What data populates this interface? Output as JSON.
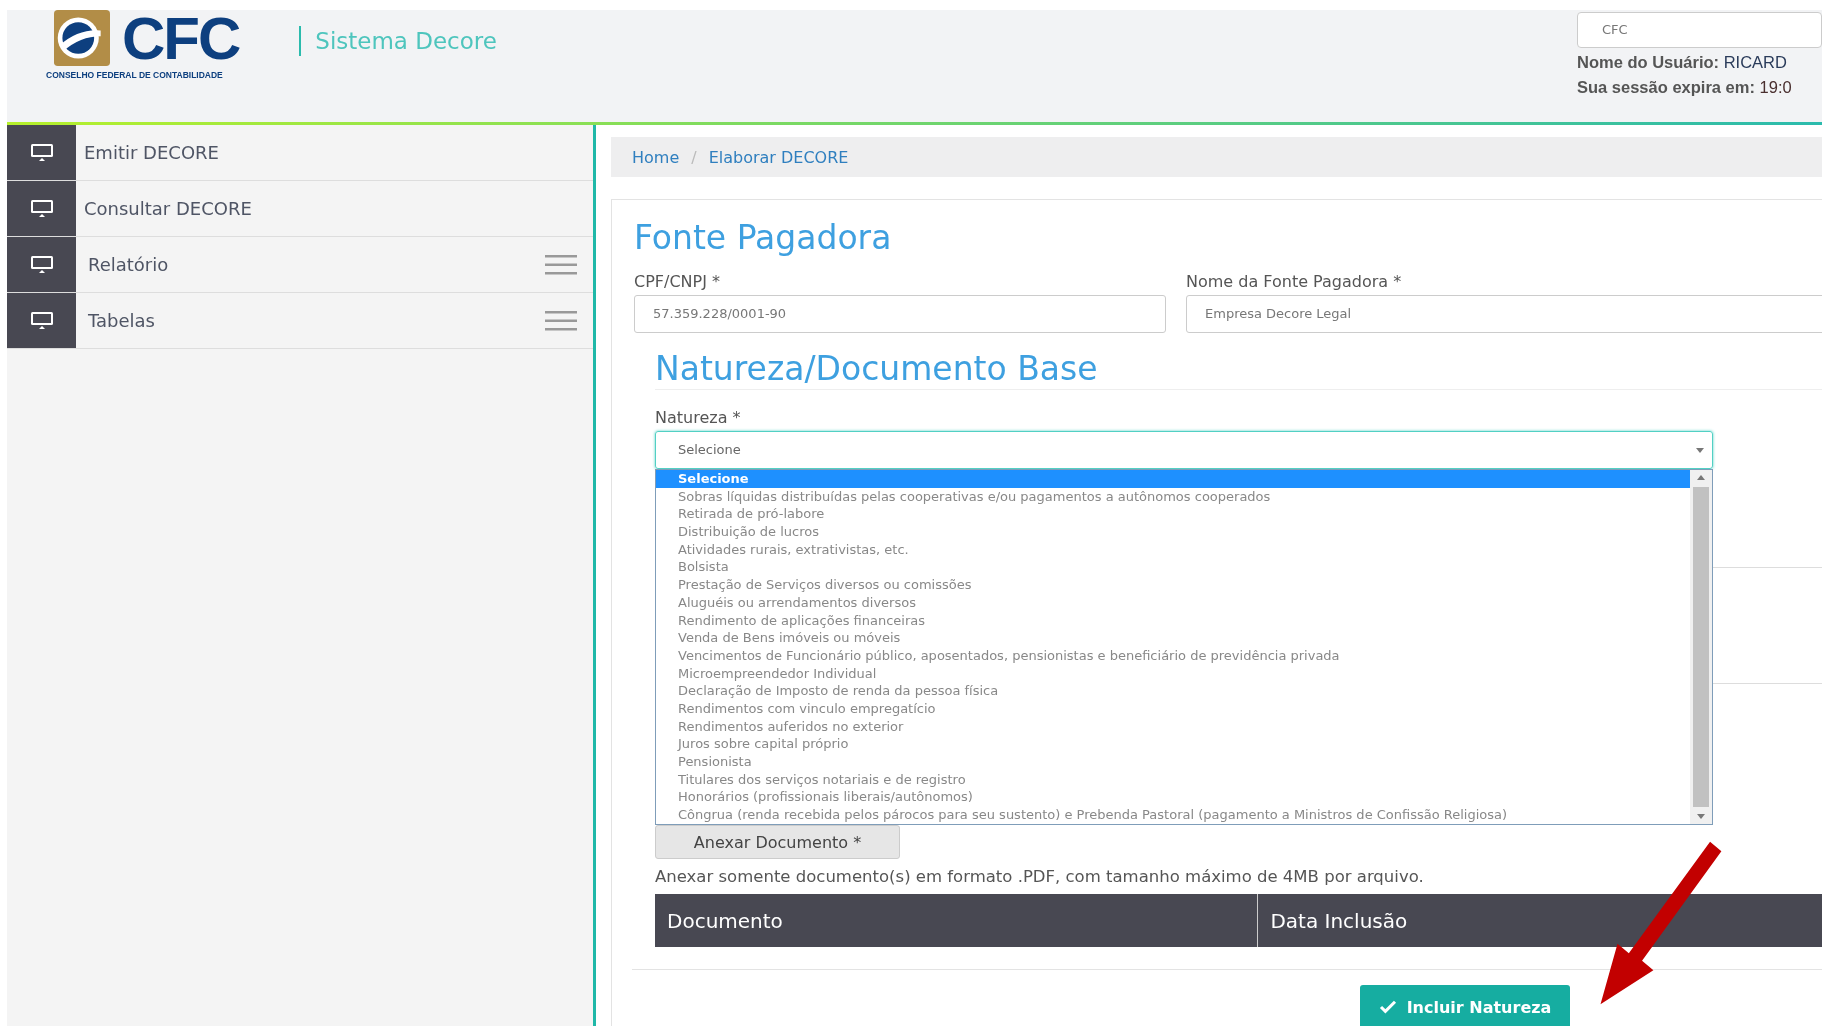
{
  "header": {
    "logo_mark": "CFC",
    "logo_caption": "CONSELHO FEDERAL DE CONTABILIDADE",
    "system_name": "Sistema Decore",
    "org_select": {
      "value": "CFC"
    },
    "user_label": "Nome do Usuário:",
    "user_value": "RICARD",
    "session_label": "Sua sessão expira em:",
    "session_value": "19:0"
  },
  "sidebar": {
    "items": [
      {
        "label": "Emitir DECORE",
        "kind": "link"
      },
      {
        "label": "Consultar DECORE",
        "kind": "link"
      },
      {
        "label": "Relatório",
        "kind": "menu"
      },
      {
        "label": "Tabelas",
        "kind": "menu"
      }
    ]
  },
  "breadcrumb": [
    "Home",
    "Elaborar DECORE"
  ],
  "breadcrumb_separator": "/",
  "fonte_pagadora": {
    "title": "Fonte Pagadora",
    "cpf_label": "CPF/CNPJ *",
    "cpf_value": "57.359.228/0001-90",
    "nome_label": "Nome da Fonte Pagadora *",
    "nome_value": "Empresa Decore Legal"
  },
  "natureza": {
    "title": "Natureza/Documento Base",
    "label": "Natureza *",
    "value": "Selecione",
    "expanded": true,
    "options": [
      {
        "label": "Selecione",
        "selected": true
      },
      {
        "label": "Sobras líquidas distribuídas pelas cooperativas e/ou pagamentos a autônomos cooperados",
        "selected": false
      },
      {
        "label": "Retirada de pró-labore",
        "selected": false
      },
      {
        "label": "Distribuição de lucros",
        "selected": false
      },
      {
        "label": "Atividades rurais, extrativistas, etc.",
        "selected": false
      },
      {
        "label": "Bolsista",
        "selected": false
      },
      {
        "label": "Prestação de Serviços diversos ou comissões",
        "selected": false
      },
      {
        "label": "Aluguéis ou arrendamentos diversos",
        "selected": false
      },
      {
        "label": "Rendimento de aplicações financeiras",
        "selected": false
      },
      {
        "label": "Venda de Bens imóveis ou móveis",
        "selected": false
      },
      {
        "label": "Vencimentos de Funcionário público, aposentados, pensionistas e beneficiário de previdência privada",
        "selected": false
      },
      {
        "label": "Microempreendedor Individual",
        "selected": false
      },
      {
        "label": "Declaração de Imposto de renda da pessoa física",
        "selected": false
      },
      {
        "label": "Rendimentos com vinculo empregatício",
        "selected": false
      },
      {
        "label": "Rendimentos auferidos no exterior",
        "selected": false
      },
      {
        "label": "Juros sobre capital próprio",
        "selected": false
      },
      {
        "label": "Pensionista",
        "selected": false
      },
      {
        "label": "Titulares dos serviços notariais e de registro",
        "selected": false
      },
      {
        "label": "Honorários (profissionais liberais/autônomos)",
        "selected": false
      },
      {
        "label": "Côngrua (renda recebida pelos párocos para seu sustento) e Prebenda Pastoral (pagamento a Ministros de Confissão Religiosa)",
        "selected": false
      }
    ],
    "attach_button": "Anexar Documento *",
    "attach_hint": "Anexar somente documento(s) em formato .PDF, com tamanho máximo de 4MB por arquivo.",
    "table_columns": [
      "Documento",
      "Data Inclusão"
    ],
    "submit_button": "Incluir Natureza"
  }
}
